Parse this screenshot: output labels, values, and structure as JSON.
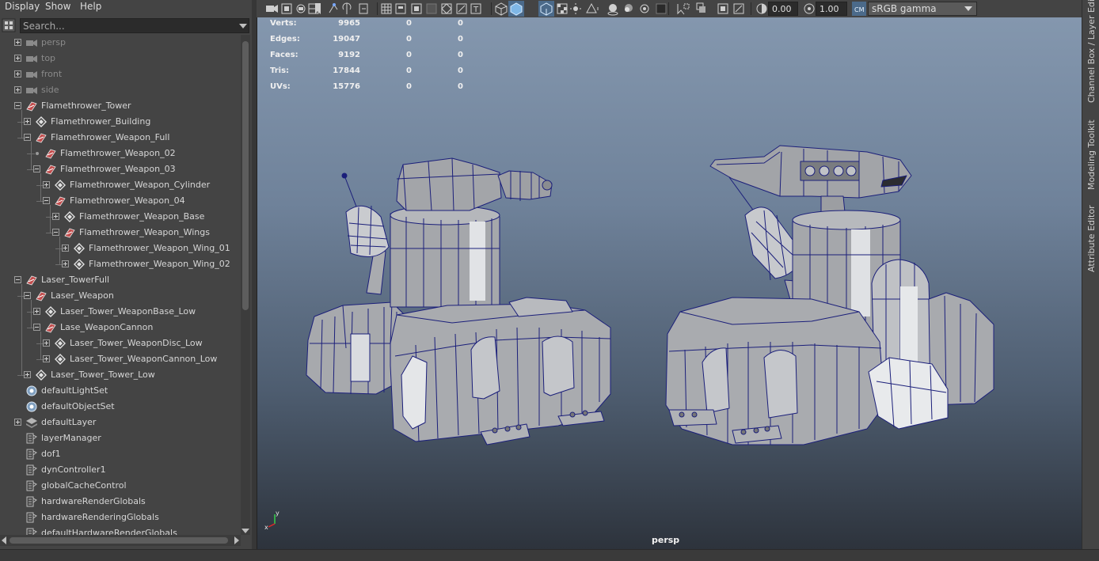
{
  "outliner": {
    "menu": [
      "Display",
      "Show",
      "Help"
    ],
    "search_placeholder": "Search...",
    "items": [
      {
        "label": "persp",
        "depth": 0,
        "expander": "plus",
        "icon": "camera-icon",
        "dim": true
      },
      {
        "label": "top",
        "depth": 0,
        "expander": "plus",
        "icon": "camera-icon",
        "dim": true
      },
      {
        "label": "front",
        "depth": 0,
        "expander": "plus",
        "icon": "camera-icon",
        "dim": true
      },
      {
        "label": "side",
        "depth": 0,
        "expander": "plus",
        "icon": "camera-icon",
        "dim": true
      },
      {
        "label": "Flamethrower_Tower",
        "depth": 0,
        "expander": "minus",
        "icon": "transform-icon"
      },
      {
        "label": "Flamethrower_Building",
        "depth": 1,
        "expander": "plus",
        "icon": "mesh-icon"
      },
      {
        "label": "Flamethrower_Weapon_Full",
        "depth": 1,
        "expander": "minus",
        "icon": "transform-icon"
      },
      {
        "label": "Flamethrower_Weapon_02",
        "depth": 2,
        "expander": "dot",
        "icon": "transform-icon"
      },
      {
        "label": "Flamethrower_Weapon_03",
        "depth": 2,
        "expander": "minus",
        "icon": "transform-icon"
      },
      {
        "label": "Flamethrower_Weapon_Cylinder",
        "depth": 3,
        "expander": "plus",
        "icon": "mesh-icon"
      },
      {
        "label": "Flamethrower_Weapon_04",
        "depth": 3,
        "expander": "minus",
        "icon": "transform-icon"
      },
      {
        "label": "Flamethrower_Weapon_Base",
        "depth": 4,
        "expander": "plus",
        "icon": "mesh-icon"
      },
      {
        "label": "Flamethrower_Weapon_Wings",
        "depth": 4,
        "expander": "minus",
        "icon": "transform-icon"
      },
      {
        "label": "Flamethrower_Weapon_Wing_01",
        "depth": 5,
        "expander": "plus",
        "icon": "mesh-icon"
      },
      {
        "label": "Flamethrower_Weapon_Wing_02",
        "depth": 5,
        "expander": "plus",
        "icon": "mesh-icon"
      },
      {
        "label": "Laser_TowerFull",
        "depth": 0,
        "expander": "minus",
        "icon": "transform-icon"
      },
      {
        "label": "Laser_Weapon",
        "depth": 1,
        "expander": "minus",
        "icon": "transform-icon"
      },
      {
        "label": "Laser_Tower_WeaponBase_Low",
        "depth": 2,
        "expander": "plus",
        "icon": "mesh-icon"
      },
      {
        "label": "Lase_WeaponCannon",
        "depth": 2,
        "expander": "minus",
        "icon": "transform-icon"
      },
      {
        "label": "Laser_Tower_WeaponDisc_Low",
        "depth": 3,
        "expander": "plus",
        "icon": "mesh-icon"
      },
      {
        "label": "Laser_Tower_WeaponCannon_Low",
        "depth": 3,
        "expander": "plus",
        "icon": "mesh-icon"
      },
      {
        "label": "Laser_Tower_Tower_Low",
        "depth": 1,
        "expander": "plus",
        "icon": "mesh-icon"
      },
      {
        "label": "defaultLightSet",
        "depth": 0,
        "expander": "none",
        "icon": "set-icon"
      },
      {
        "label": "defaultObjectSet",
        "depth": 0,
        "expander": "none",
        "icon": "set-icon"
      },
      {
        "label": "defaultLayer",
        "depth": 0,
        "expander": "plus",
        "icon": "layer-icon"
      },
      {
        "label": "layerManager",
        "depth": 0,
        "expander": "none",
        "icon": "node-icon"
      },
      {
        "label": "dof1",
        "depth": 0,
        "expander": "none",
        "icon": "node-icon"
      },
      {
        "label": "dynController1",
        "depth": 0,
        "expander": "none",
        "icon": "node-icon"
      },
      {
        "label": "globalCacheControl",
        "depth": 0,
        "expander": "none",
        "icon": "node-icon"
      },
      {
        "label": "hardwareRenderGlobals",
        "depth": 0,
        "expander": "none",
        "icon": "node-icon"
      },
      {
        "label": "hardwareRenderingGlobals",
        "depth": 0,
        "expander": "none",
        "icon": "node-icon"
      },
      {
        "label": "defaultHardwareRenderGlobals",
        "depth": 0,
        "expander": "none",
        "icon": "node-icon"
      }
    ]
  },
  "toolbar": {
    "exposure_value": "0.00",
    "gamma_value": "1.00",
    "color_space": "sRGB gamma"
  },
  "hud": {
    "rows": [
      {
        "label": "Verts:",
        "total": "9965",
        "selected": "0",
        "components": "0"
      },
      {
        "label": "Edges:",
        "total": "19047",
        "selected": "0",
        "components": "0"
      },
      {
        "label": "Faces:",
        "total": "9192",
        "selected": "0",
        "components": "0"
      },
      {
        "label": "Tris:",
        "total": "17844",
        "selected": "0",
        "components": "0"
      },
      {
        "label": "UVs:",
        "total": "15776",
        "selected": "0",
        "components": "0"
      }
    ]
  },
  "viewport": {
    "camera": "persp",
    "axis_x_label": "x",
    "axis_y_label": "y",
    "wire_color": "#1b1f7a"
  },
  "right_tabs": [
    "Channel Box / Layer Editor",
    "Modeling Toolkit",
    "Attribute Editor"
  ]
}
